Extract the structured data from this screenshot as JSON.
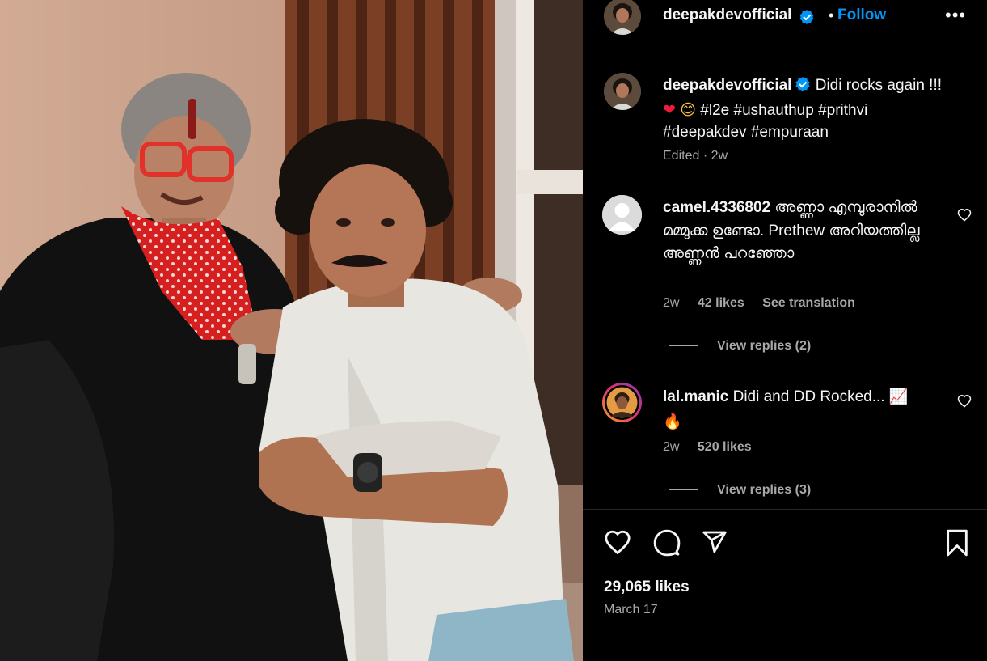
{
  "post": {
    "author": "deepakdevofficial",
    "follow_label": "Follow",
    "header_separator": "•",
    "more_label": "•••"
  },
  "caption": {
    "username": "deepakdevofficial",
    "text_start": "Didi rocks again !!! ",
    "emoji_heart": "❤",
    "emoji_smile": "😊",
    "hashtags": "#l2e #ushauthup #prithvi #deepakdev #empuraan",
    "edited_label": "Edited",
    "separator": "·",
    "time": "2w"
  },
  "comments": [
    {
      "username": "camel.4336802",
      "text": "അണ്ണാ എമ്പുരാനിൽ മമ്മുക്ക ഉണ്ടോ. Prethew അറിയത്തില്ല അണ്ണൻ പറഞ്ഞോ",
      "time": "2w",
      "likes": "42 likes",
      "translate_label": "See translation",
      "view_replies": "View replies (2)"
    },
    {
      "username": "lal.manic",
      "text": "Didi and DD Rocked... ",
      "emoji_chart": "📈",
      "emoji_fire": "🔥",
      "time": "2w",
      "likes": "520 likes",
      "view_replies": "View replies (3)"
    }
  ],
  "stats": {
    "likes": "29,065 likes",
    "date": "March 17"
  },
  "icons": [
    "verified-badge-icon",
    "more-options-icon",
    "heart-icon",
    "comment-icon",
    "share-icon",
    "bookmark-icon",
    "default-avatar-icon"
  ],
  "colors": {
    "background": "#000000",
    "text": "#f5f5f5",
    "secondary": "#a8a8a8",
    "link": "#0095f6",
    "divider": "#262626",
    "heart_emoji": "#ed1c3b"
  }
}
